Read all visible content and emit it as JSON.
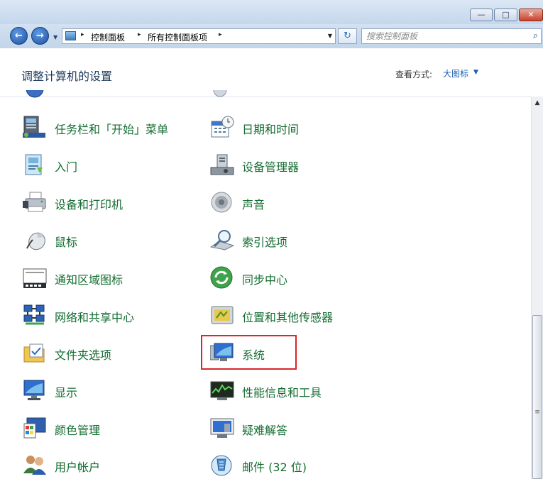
{
  "window": {
    "minimize_glyph": "—",
    "maximize_glyph": "□",
    "close_glyph": "✕"
  },
  "nav": {
    "back_glyph": "←",
    "forward_glyph": "→",
    "dropdown_glyph": "▼"
  },
  "address": {
    "breadcrumbs": [
      "控制面板",
      "所有控制面板项"
    ],
    "separator": "▸",
    "dropdown_glyph": "▼",
    "refresh_glyph": "↻"
  },
  "search": {
    "placeholder": "搜索控制面板",
    "icon_glyph": "⌕"
  },
  "header": {
    "title": "调整计算机的设置",
    "view_label": "查看方式:",
    "view_value": "大图标",
    "view_arrow": "▼"
  },
  "scrollbar": {
    "up_glyph": "▲",
    "grip_glyph": "≡"
  },
  "items_left": [
    {
      "label": "任务栏和「开始」菜单",
      "icon": "taskbar-icon"
    },
    {
      "label": "入门",
      "icon": "getting-started-icon"
    },
    {
      "label": "设备和打印机",
      "icon": "printer-icon"
    },
    {
      "label": "鼠标",
      "icon": "mouse-icon"
    },
    {
      "label": "通知区域图标",
      "icon": "notification-area-icon"
    },
    {
      "label": "网络和共享中心",
      "icon": "network-icon"
    },
    {
      "label": "文件夹选项",
      "icon": "folder-options-icon"
    },
    {
      "label": "显示",
      "icon": "display-icon"
    },
    {
      "label": "颜色管理",
      "icon": "color-management-icon"
    },
    {
      "label": "用户帐户",
      "icon": "user-accounts-icon"
    }
  ],
  "items_right": [
    {
      "label": "日期和时间",
      "icon": "date-time-icon"
    },
    {
      "label": "设备管理器",
      "icon": "device-manager-icon"
    },
    {
      "label": "声音",
      "icon": "speaker-icon"
    },
    {
      "label": "索引选项",
      "icon": "indexing-icon"
    },
    {
      "label": "同步中心",
      "icon": "sync-center-icon"
    },
    {
      "label": "位置和其他传感器",
      "icon": "sensors-icon"
    },
    {
      "label": "系统",
      "icon": "system-icon"
    },
    {
      "label": "性能信息和工具",
      "icon": "performance-icon"
    },
    {
      "label": "疑难解答",
      "icon": "troubleshooting-icon"
    },
    {
      "label": "邮件 (32 位)",
      "icon": "mail-icon"
    }
  ]
}
